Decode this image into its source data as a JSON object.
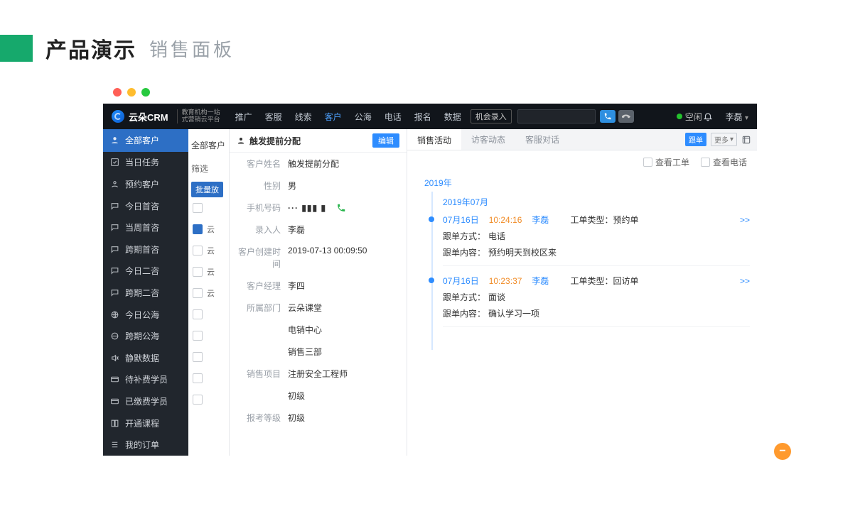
{
  "page": {
    "title1": "产品演示",
    "title2": "销售面板"
  },
  "topbar": {
    "brand": "云朵CRM",
    "brand_sub1": "教育机构一站",
    "brand_sub2": "式营销云平台",
    "nav": [
      "推广",
      "客服",
      "线索",
      "客户",
      "公海",
      "电话",
      "报名",
      "数据"
    ],
    "nav_active": "客户",
    "entry_btn": "机会录入",
    "status": "空闲",
    "user": "李磊"
  },
  "sidebar": {
    "top": "全部客户",
    "items": [
      "当日任务",
      "预约客户",
      "今日首咨",
      "当周首咨",
      "跨期首咨",
      "今日二咨",
      "跨期二咨",
      "今日公海",
      "跨期公海",
      "静默数据",
      "待补费学员",
      "已缴费学员",
      "开通课程",
      "我的订单"
    ]
  },
  "list": {
    "title": "全部客户",
    "filter_label": "筛选",
    "batch_btn": "批量放",
    "cells": [
      "云",
      "云",
      "云",
      "云"
    ]
  },
  "detail": {
    "title": "触发提前分配",
    "edit": "编辑",
    "labels": {
      "name": "客户姓名",
      "gender": "性别",
      "phone": "手机号码",
      "creator": "录入人",
      "created": "客户创建时间",
      "manager": "客户经理",
      "dept": "所属部门",
      "project": "销售项目",
      "level": "报考等级"
    },
    "values": {
      "name": "触发提前分配",
      "gender": "男",
      "phone_masked": "··· ▮▮▮ ▮",
      "creator": "李磊",
      "created": "2019-07-13 00:09:50",
      "manager": "李四",
      "dept1": "云朵课堂",
      "dept2": "电销中心",
      "dept3": "销售三部",
      "project": "注册安全工程师",
      "project_sub": "初级",
      "level": "初级"
    }
  },
  "activity": {
    "tabs": [
      "销售活动",
      "访客动态",
      "客服对话"
    ],
    "active_tab": "销售活动",
    "pill_follow": "跟单",
    "pill_more": "更多",
    "filter_ticket": "查看工单",
    "filter_call": "查看电话",
    "year": "2019年",
    "month": "2019年07月",
    "entries": [
      {
        "date": "07月16日",
        "time": "10:24:16",
        "user": "李磊",
        "type_label": "工单类型：",
        "type_value": "预约单",
        "method_label": "跟单方式：",
        "method_value": "电话",
        "content_label": "跟单内容：",
        "content_value": "预约明天到校区来",
        "more": ">>"
      },
      {
        "date": "07月16日",
        "time": "10:23:37",
        "user": "李磊",
        "type_label": "工单类型：",
        "type_value": "回访单",
        "method_label": "跟单方式：",
        "method_value": "面谈",
        "content_label": "跟单内容：",
        "content_value": "确认学习一项",
        "more": ">>"
      }
    ]
  }
}
